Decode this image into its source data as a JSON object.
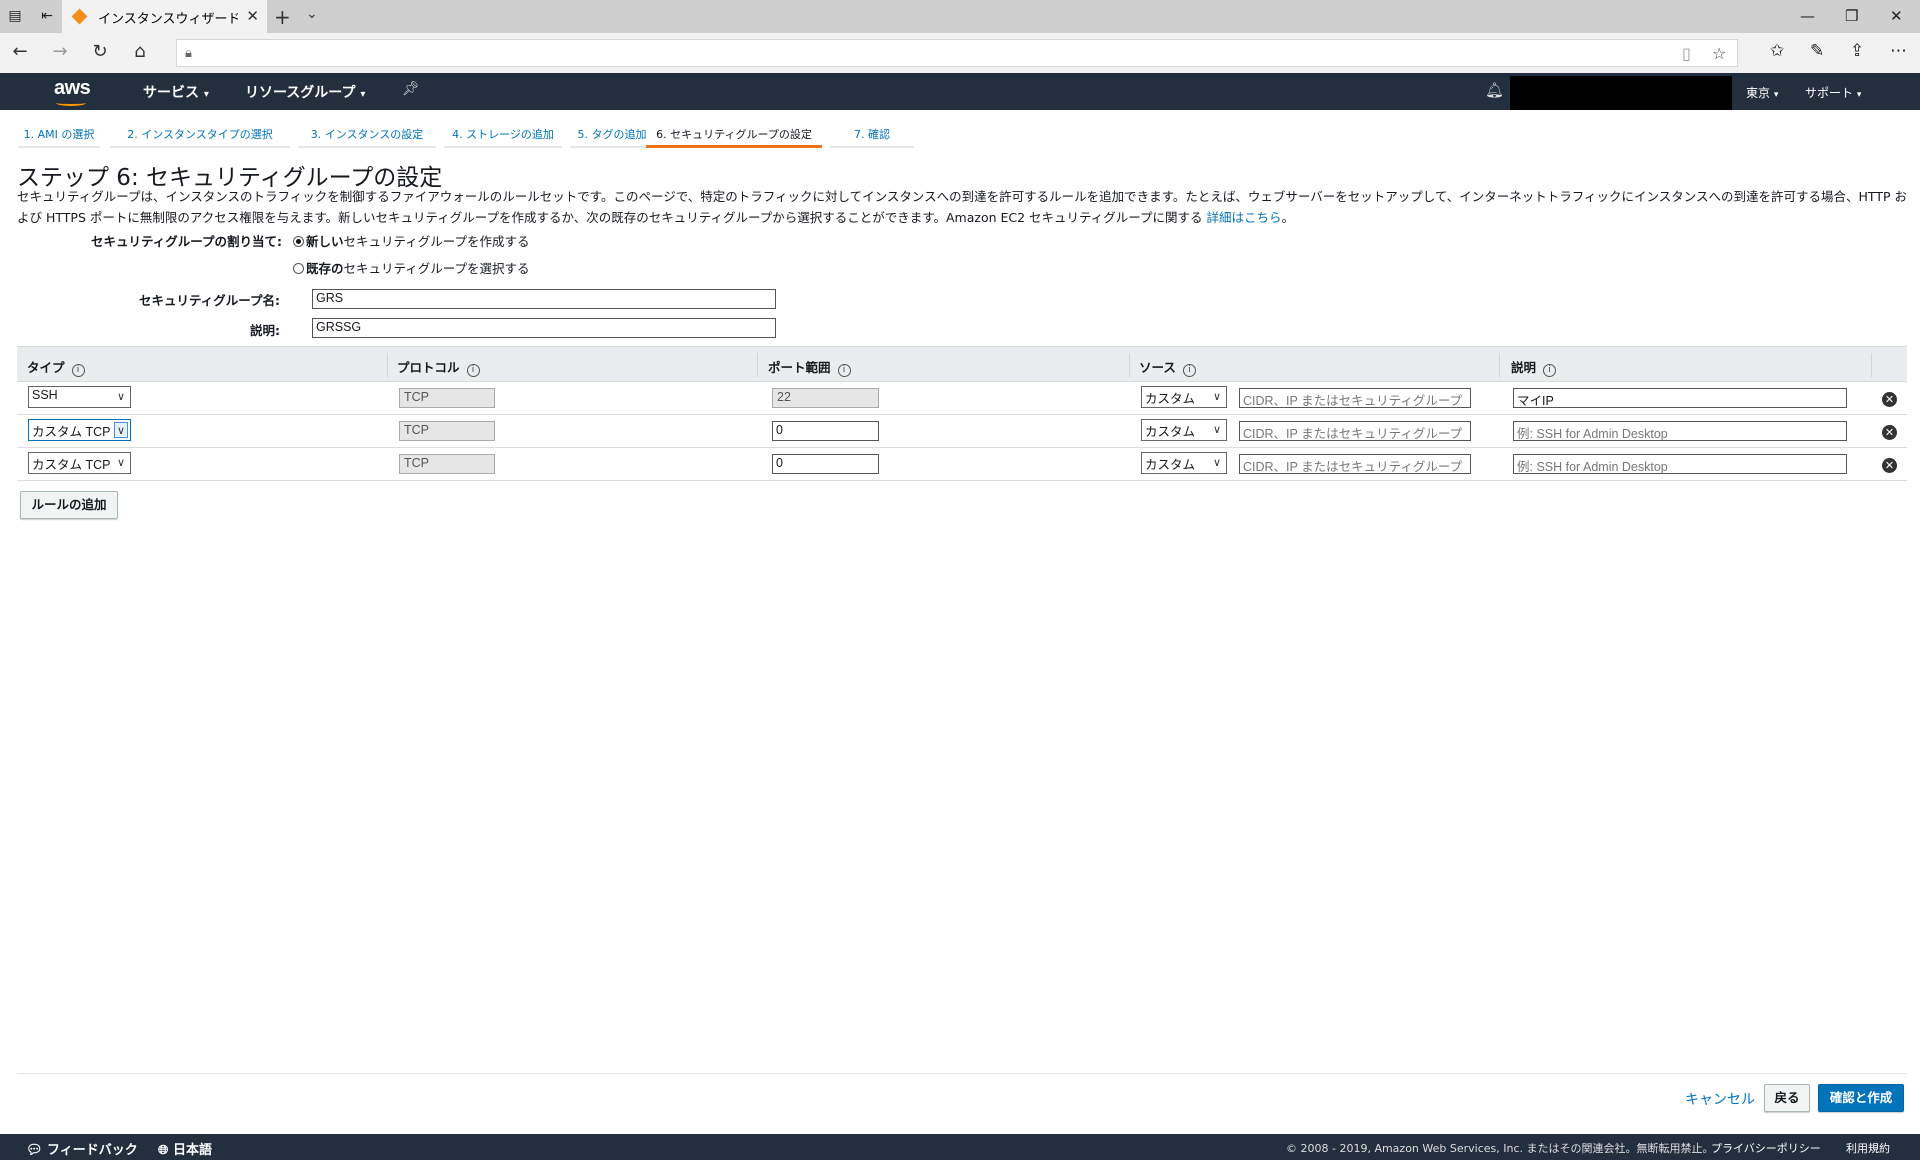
{
  "browser": {
    "tab_title": "インスタンスウィザードを起動",
    "url": ""
  },
  "aws": {
    "logo": "aws",
    "services": "サービス",
    "resource_groups": "リソースグループ",
    "region": "東京",
    "support": "サポート"
  },
  "steps": [
    {
      "label": "1. AMI の選択"
    },
    {
      "label": "2. インスタンスタイプの選択"
    },
    {
      "label": "3. インスタンスの設定"
    },
    {
      "label": "4. ストレージの追加"
    },
    {
      "label": "5. タグの追加"
    },
    {
      "label": "6. セキュリティグループの設定"
    },
    {
      "label": "7. 確認"
    }
  ],
  "page": {
    "title": "ステップ 6: セキュリティグループの設定",
    "description": "セキュリティグループは、インスタンスのトラフィックを制御するファイアウォールのルールセットです。このページで、特定のトラフィックに対してインスタンスへの到達を許可するルールを追加できます。たとえば、ウェブサーバーをセットアップして、インターネットトラフィックにインスタンスへの到達を許可する場合、HTTP および HTTPS ポートに無制限のアクセス権限を与えます。新しいセキュリティグループを作成するか、次の既存のセキュリティグループから選択することができます。Amazon EC2 セキュリティグループに関する",
    "details_link": "詳細はこちら",
    "period": "。"
  },
  "assign": {
    "label": "セキュリティグループの割り当て:",
    "option_new_bold": "新しい",
    "option_new_rest": "セキュリティグループを作成する",
    "option_existing_bold": "既存の",
    "option_existing_rest": "セキュリティグループを選択する",
    "selected": "new"
  },
  "form": {
    "name_label": "セキュリティグループ名:",
    "name_value": "GRS",
    "desc_label": "説明:",
    "desc_value": "GRSSG"
  },
  "table": {
    "headers": {
      "type": "タイプ",
      "protocol": "プロトコル",
      "port": "ポート範囲",
      "source": "ソース",
      "description": "説明"
    },
    "info_glyph": "i",
    "source_placeholder": "CIDR、IP またはセキュリティグループ",
    "rows": [
      {
        "type": "SSH",
        "protocol": "TCP",
        "port": "22",
        "source_type": "カスタム",
        "source_value": "",
        "description": "マイIP",
        "desc_placeholder": ""
      },
      {
        "type": "カスタム TCP",
        "protocol": "TCP",
        "port": "0",
        "source_type": "カスタム",
        "source_value": "",
        "description": "",
        "desc_placeholder": "例: SSH for Admin Desktop"
      },
      {
        "type": "カスタム TCP",
        "protocol": "TCP",
        "port": "0",
        "source_type": "カスタム",
        "source_value": "",
        "description": "",
        "desc_placeholder": "例: SSH for Admin Desktop"
      }
    ]
  },
  "buttons": {
    "add_rule": "ルールの追加",
    "cancel": "キャンセル",
    "back": "戻る",
    "review": "確認と作成"
  },
  "footer": {
    "feedback": "フィードバック",
    "language": "日本語",
    "copyright": "© 2008 - 2019, Amazon Web Services, Inc. またはその関連会社。無断転用禁止。",
    "privacy": "プライバシーポリシー",
    "terms": "利用規約"
  },
  "colors": {
    "aws_nav": "#232f3e",
    "accent_orange": "#ec7211",
    "link_blue": "#0073bb"
  }
}
